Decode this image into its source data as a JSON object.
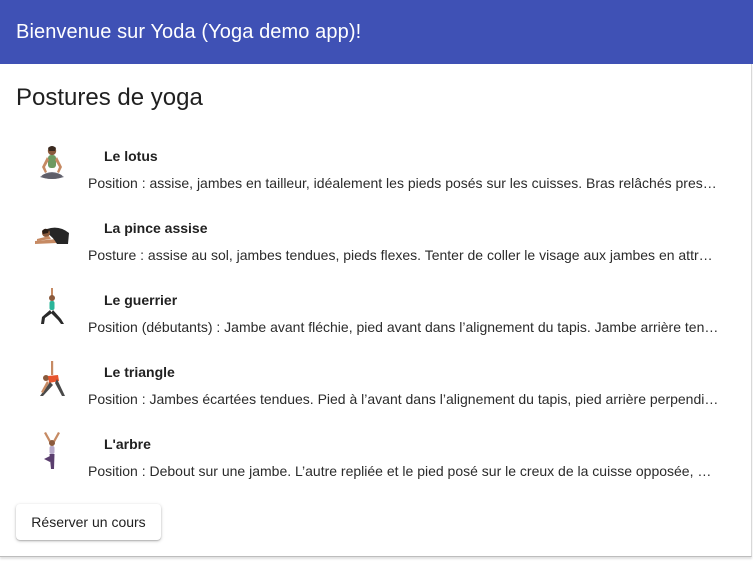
{
  "toolbar": {
    "title": "Bienvenue sur Yoda (Yoga demo app)!",
    "color": "#3f51b5"
  },
  "main": {
    "title": "Postures de yoga",
    "postures": [
      {
        "name": "Le lotus",
        "description": "Position : assise, jambes en tailleur, idéalement les pieds posés sur les cuisses. Bras relâchés presque tendus, mains posées sur les genoux.",
        "icon": "lotus-pose-icon"
      },
      {
        "name": "La pince assise",
        "description": "Posture : assise au sol, jambes tendues, pieds flexes. Tenter de coller le visage aux jambes en attrapant les pieds avec les mains.",
        "icon": "seated-forward-bend-icon"
      },
      {
        "name": "Le guerrier",
        "description": "Position (débutants) : Jambe avant fléchie, pied avant dans l’alignement du tapis. Jambe arrière tendue, pied arrière à 45 degrés.",
        "icon": "warrior-pose-icon"
      },
      {
        "name": "Le triangle",
        "description": "Position : Jambes écartées tendues. Pied à l’avant dans l’alignement du tapis, pied arrière perpendiculaire au pied avant.",
        "icon": "triangle-pose-icon"
      },
      {
        "name": "L'arbre",
        "description": "Position : Debout sur une jambe. L’autre repliée et le pied posé sur le creux de la cuisse opposée, et sur la pointe des pieds.",
        "icon": "tree-pose-icon"
      }
    ],
    "book_button": "Réserver un cours"
  }
}
